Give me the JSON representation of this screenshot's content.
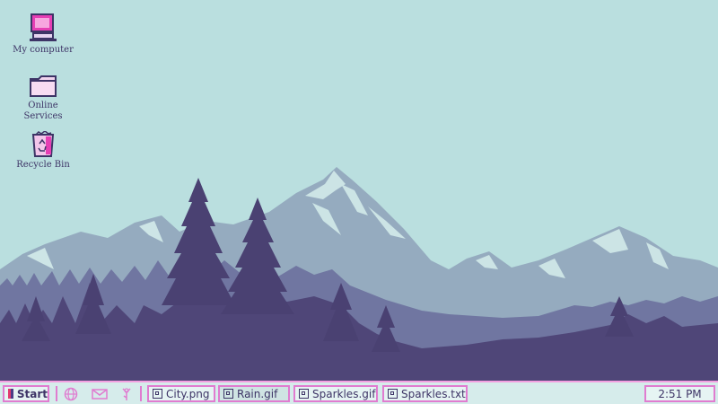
{
  "desktop": {
    "icons": [
      {
        "label": "My computer",
        "icon": "computer-icon"
      },
      {
        "label": "Online\nServices",
        "icon": "folder-icon"
      },
      {
        "label": "Recycle Bin",
        "icon": "recycle-bin-icon"
      }
    ]
  },
  "taskbar": {
    "start_label": "Start",
    "quick_launch": [
      "globe-icon",
      "mail-icon",
      "flower-icon"
    ],
    "windows": [
      {
        "label": "City.png",
        "icon": "image-file-icon"
      },
      {
        "label": "Rain.gif",
        "icon": "image-file-icon",
        "active": true
      },
      {
        "label": "Sparkles.gif",
        "icon": "image-file-icon"
      },
      {
        "label": "Sparkles.txt",
        "icon": "text-file-icon"
      }
    ],
    "clock": "2:51 PM"
  },
  "colors": {
    "sky": "#badfdf",
    "accent": "#e07cd0",
    "text": "#3d3466"
  }
}
